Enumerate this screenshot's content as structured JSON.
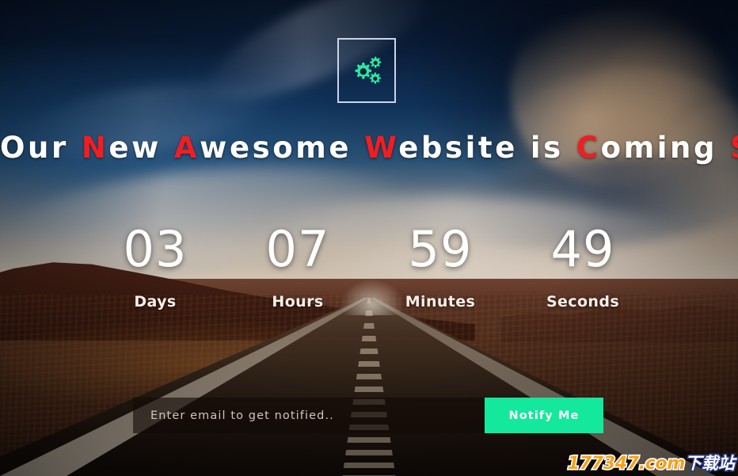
{
  "page": {
    "title_words": [
      {
        "text": "Our",
        "accent_char": "",
        "accent": false
      },
      {
        "text": "New",
        "accent_char": "N",
        "accent": true
      },
      {
        "text": "Awesome",
        "accent_char": "A",
        "accent": true
      },
      {
        "text": "Website",
        "accent_char": "W",
        "accent": true
      },
      {
        "text": "is",
        "accent_char": "",
        "accent": false
      },
      {
        "text": "Coming",
        "accent_char": "C",
        "accent": true
      },
      {
        "text": "Soon",
        "accent_char": "S",
        "accent": true
      }
    ],
    "title_plain": "Our New Awesome Website is Coming Soon"
  },
  "logo": {
    "icon": "gears-icon",
    "color": "#2ce5a5",
    "border_color": "#ccd4e6"
  },
  "countdown": {
    "units": [
      {
        "value": "03",
        "label": "Days"
      },
      {
        "value": "07",
        "label": "Hours"
      },
      {
        "value": "59",
        "label": "Minutes"
      },
      {
        "value": "49",
        "label": "Seconds"
      }
    ]
  },
  "subscribe": {
    "email_placeholder": "Enter email to get notified..",
    "email_value": "",
    "button_label": "Notify Me",
    "button_color": "#13e89c"
  },
  "watermark": {
    "domain": "177347.com",
    "suffix": "下载站",
    "domain_color": "#f5a11b",
    "suffix_color": "#ffffff"
  },
  "theme": {
    "accent_red": "#f01e22",
    "accent_green": "#13e89c",
    "text_white": "#ffffff",
    "sky_top": "#08162c",
    "ground": "#46281a"
  }
}
